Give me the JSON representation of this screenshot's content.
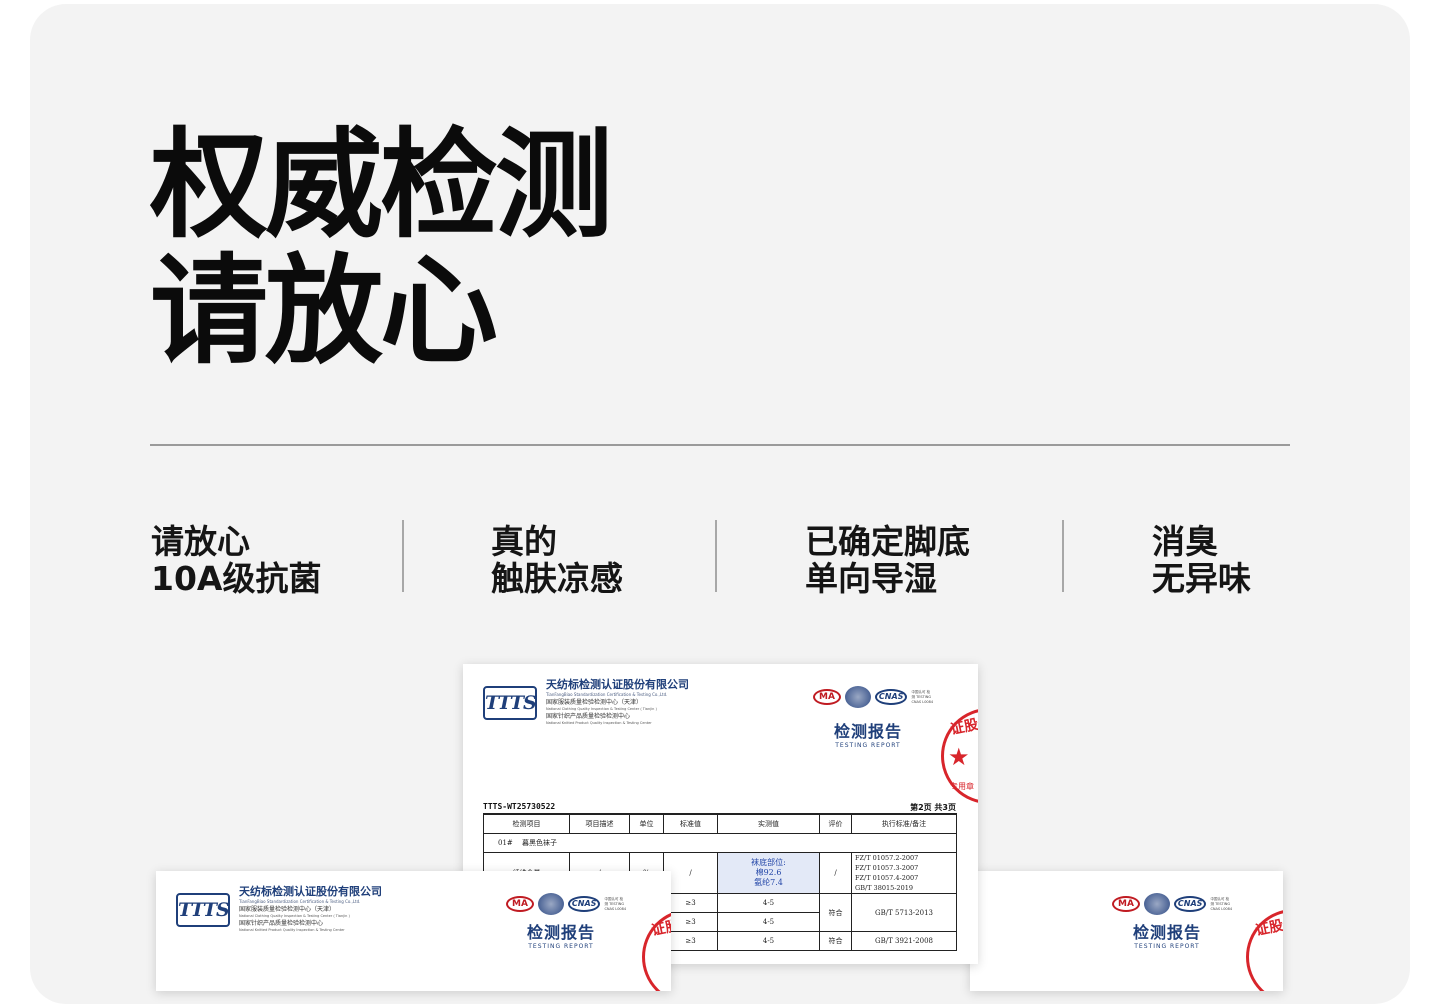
{
  "headline": {
    "line1": "权威检测",
    "line2": "请放心"
  },
  "features": [
    {
      "line1": "请放心",
      "line2": "10A级抗菌"
    },
    {
      "line1": "真的",
      "line2": "触肤凉感"
    },
    {
      "line1": "已确定脚底",
      "line2": "单向导湿"
    },
    {
      "line1": "消臭",
      "line2": "无异味"
    }
  ],
  "report": {
    "logo": "TTTS",
    "org_cn": "天纺标检测认证股份有限公司",
    "org_en": "TianFangBiao Standardization Certification & Testing Co.,Ltd.",
    "sub1_cn": "国家服装质量检验检测中心（天津）",
    "sub1_en": "National Clothing Quality Inspection & Testing Center ( Tianjin )",
    "sub2_cn": "国家针织产品质量检验检测中心",
    "sub2_en": "National Knitted Product Quality Inspection & Testing Center",
    "cert_ma": "MA",
    "cert_cnas": "CNAS",
    "cert_small": "中国认可 检测 TESTING CNAS L0084",
    "title_cn": "检测报告",
    "title_en": "TESTING REPORT",
    "seal_text": "证股份",
    "seal_star": "★",
    "seal_bottom": "专用章",
    "code": "TTTS-WT25730522",
    "page": "第2页  共3页",
    "table": {
      "headers": [
        "检测项目",
        "项目描述",
        "单位",
        "标准值",
        "实测值",
        "评价",
        "执行标准/备注"
      ],
      "sample": "01#　 暮黑色袜子",
      "fiber_item": "纤维含量",
      "fiber_desc": "/",
      "fiber_unit": "%",
      "fiber_std": "/",
      "fiber_value1": "袜底部位:",
      "fiber_value2": "棉92.6",
      "fiber_value3": "氨纶7.4",
      "fiber_eval": "/",
      "fiber_ref1": "FZ/T 01057.2-2007",
      "fiber_ref2": "FZ/T 01057.3-2007",
      "fiber_ref3": "FZ/T 01057.4-2007",
      "fiber_ref4": "GB/T 38015-2019",
      "rows": [
        {
          "std": "≥3",
          "value": "4-5"
        },
        {
          "std": "≥3",
          "value": "4-5"
        },
        {
          "std": "≥3",
          "value": "4-5"
        }
      ],
      "eval_ok": "符合",
      "ref_gb": "GB/T 5713-2013",
      "ref_gb2": "GB/T 3921-2008"
    }
  }
}
